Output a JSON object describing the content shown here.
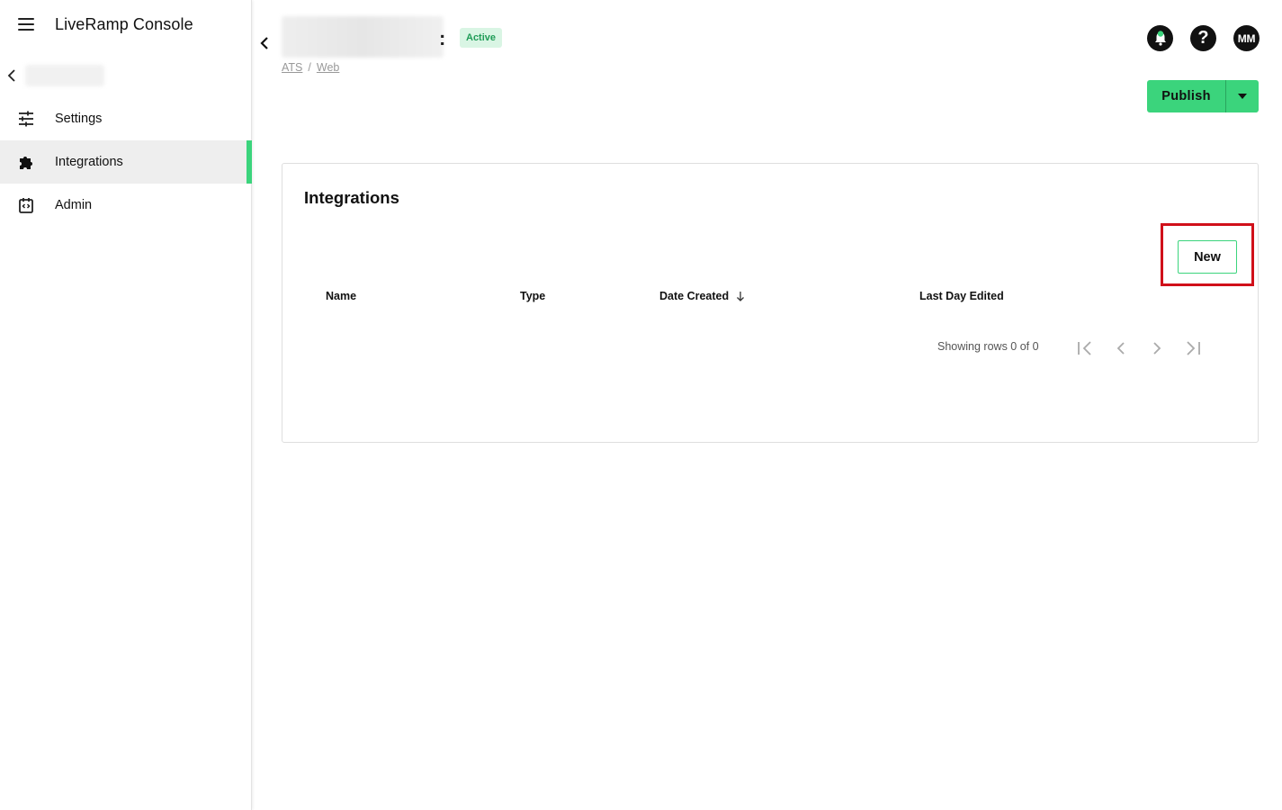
{
  "app": {
    "title": "LiveRamp Console"
  },
  "sidebar": {
    "items": [
      {
        "label": "Settings",
        "icon": "sliders-icon"
      },
      {
        "label": "Integrations",
        "icon": "puzzle-icon",
        "active": true
      },
      {
        "label": "Admin",
        "icon": "code-calendar-icon"
      }
    ]
  },
  "header": {
    "status": "Active",
    "breadcrumb": [
      "ATS",
      "Web"
    ],
    "avatar_initials": "MM",
    "help_glyph": "?"
  },
  "actions": {
    "publish_label": "Publish"
  },
  "integrations": {
    "title": "Integrations",
    "new_label": "New",
    "columns": [
      "Name",
      "Type",
      "Date Created",
      "Last Day Edited"
    ],
    "rows": [],
    "rows_info": "Showing rows 0 of 0"
  },
  "colors": {
    "accent": "#3bd47c",
    "highlight": "#d0101a",
    "badge_bg": "#d9f5e4",
    "badge_text": "#1f9c57"
  }
}
